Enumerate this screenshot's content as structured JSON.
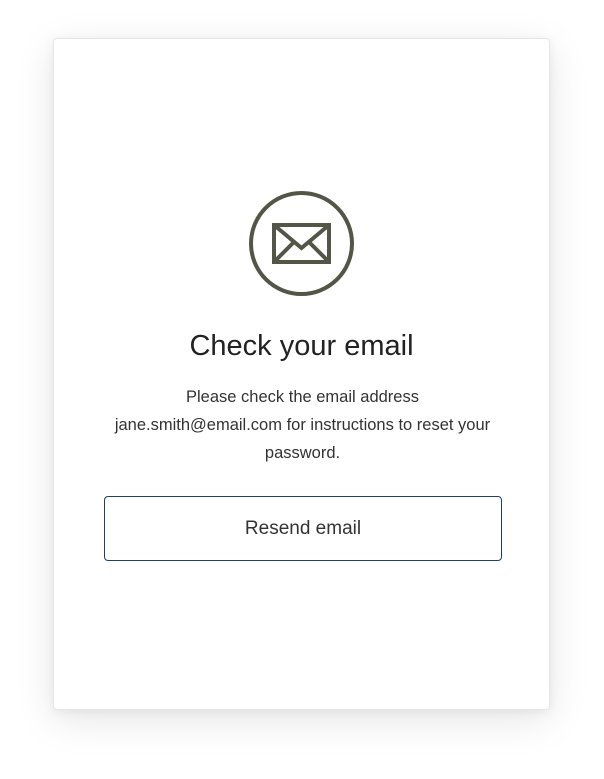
{
  "icon": "envelope-icon",
  "colors": {
    "icon": "#535646",
    "button_border": "#1f3f66",
    "title": "#222222",
    "text": "#333333"
  },
  "title": "Check your email",
  "message": "Please check the email address jane.smith@email.com for instructions to reset your password.",
  "resend_button_label": "Resend email"
}
